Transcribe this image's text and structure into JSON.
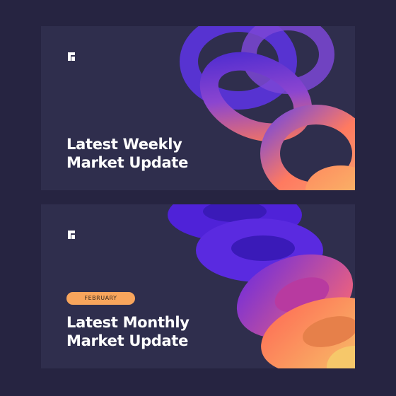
{
  "cards": [
    {
      "title_line1": "Latest Weekly",
      "title_line2": "Market Update",
      "logo": "brand-logo-icon",
      "art": "chain-rings-3d"
    },
    {
      "badge": "FEBRUARY",
      "title_line1": "Latest Monthly",
      "title_line2": "Market Update",
      "logo": "brand-logo-icon",
      "art": "stacked-rings-3d"
    }
  ],
  "colors": {
    "background": "#262441",
    "card": "#2f2e4d",
    "badge": "#f8a55c",
    "purple": "#5a2fd6",
    "orange": "#ff7a4a",
    "yellow": "#f6c86a"
  }
}
